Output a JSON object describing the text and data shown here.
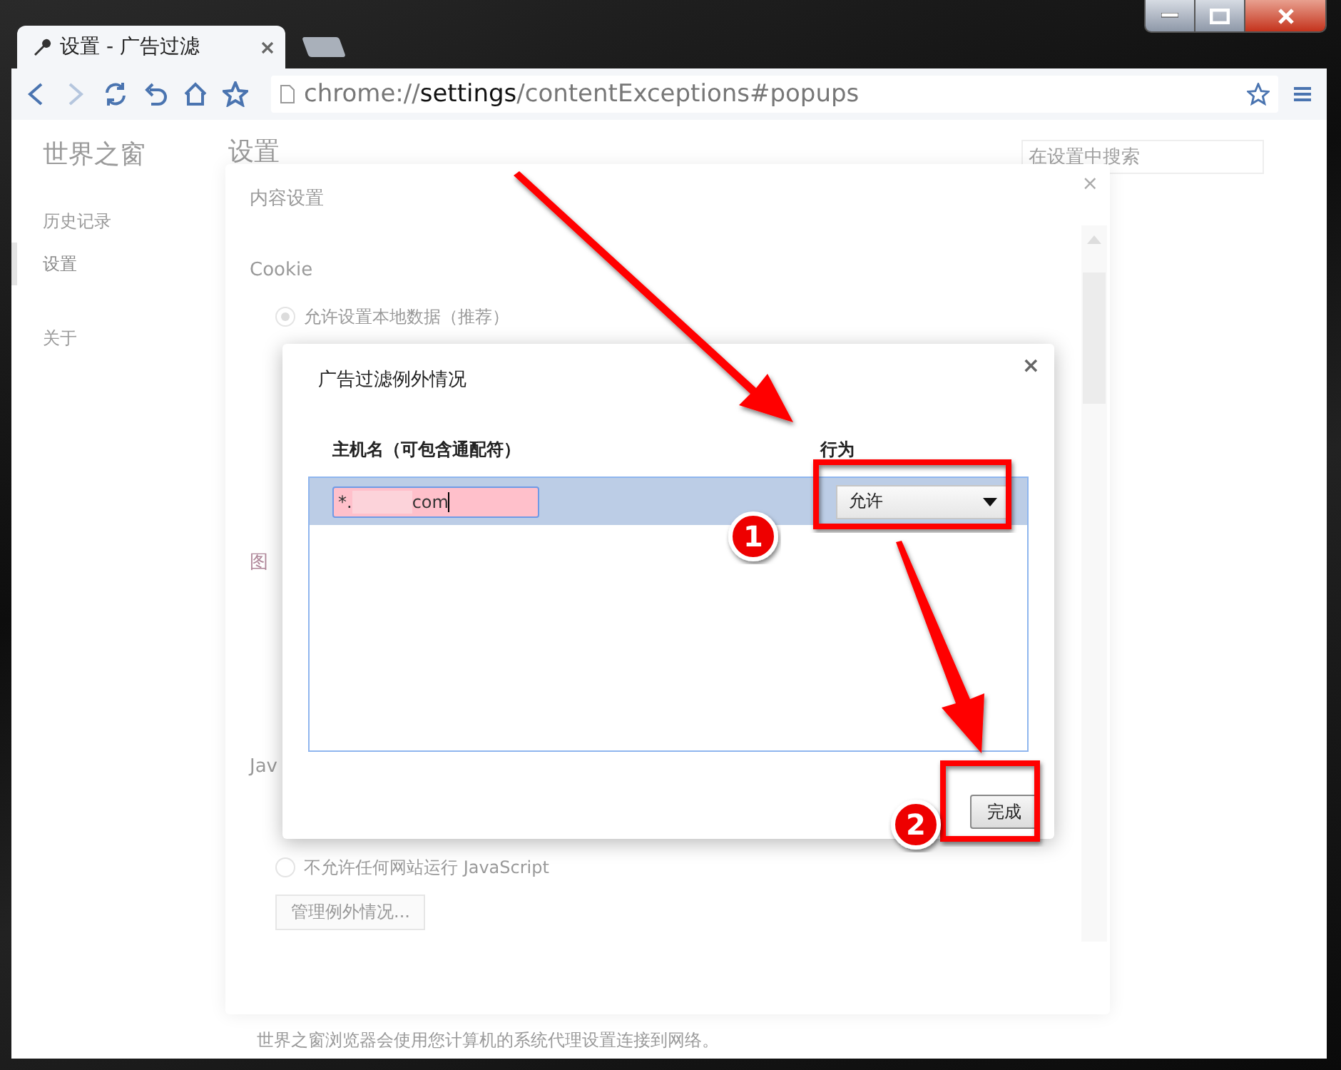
{
  "window": {
    "tab_title": "设置 - 广告过滤"
  },
  "address_bar": {
    "scheme": "chrome://",
    "host": "settings",
    "path": "/contentExceptions#popups"
  },
  "settings_page": {
    "brand": "世界之窗",
    "title": "设置",
    "search": {
      "placeholder": "在设置中搜索"
    },
    "nav": [
      {
        "label": "历史记录",
        "selected": false
      },
      {
        "label": "设置",
        "selected": true
      },
      {
        "label": "关于",
        "selected": false
      }
    ],
    "footer_text": "世界之窗浏览器会使用您计算机的系统代理设置连接到网络。"
  },
  "content_settings": {
    "title": "内容设置",
    "close": "×",
    "sections": [
      {
        "heading": "Cookie",
        "options": [
          {
            "label": "允许设置本地数据（推荐）",
            "selected": true
          }
        ]
      },
      {
        "heading": "图"
      },
      {
        "heading": "Jav",
        "options": [
          {
            "label": "不允许任何网站运行 JavaScript",
            "selected": false
          }
        ],
        "button": "管理例外情况..."
      }
    ]
  },
  "exceptions_dialog": {
    "title": "广告过滤例外情况",
    "close": "×",
    "columns": [
      "主机名（可包含通配符）",
      "行为"
    ],
    "rows": [
      {
        "value_parts": [
          "*.",
          "com"
        ],
        "behavior": "允许",
        "selected": true
      }
    ],
    "done_button": "完成"
  },
  "annotations": [
    {
      "number": "1"
    },
    {
      "number": "2"
    }
  ]
}
